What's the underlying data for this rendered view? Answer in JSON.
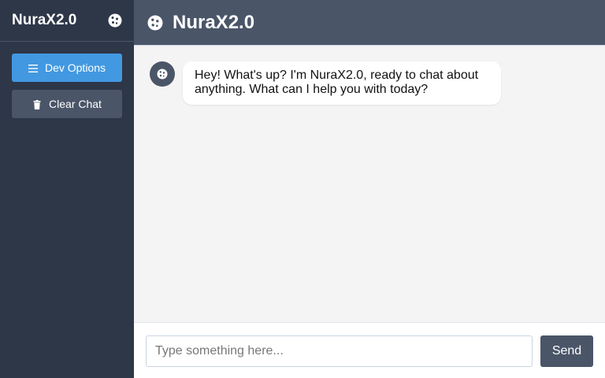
{
  "app": {
    "name": "NuraX2.0",
    "logo_icon": "cookie-icon"
  },
  "sidebar": {
    "title": "NuraX2.0",
    "buttons": [
      {
        "label": "Dev Options",
        "icon": "menu-icon",
        "color": "#4299e1"
      },
      {
        "label": "Clear Chat",
        "icon": "trash-icon",
        "color": "#4a5568"
      }
    ]
  },
  "header": {
    "title": "NuraX2.0"
  },
  "chat": {
    "messages": [
      {
        "sender": "bot",
        "avatar_icon": "cookie-icon",
        "text": "Hey! What's up? I'm NuraX2.0, ready to chat about anything. What can I help you with today?"
      }
    ]
  },
  "composer": {
    "placeholder": "Type something here...",
    "value": "",
    "send_label": "Send"
  },
  "colors": {
    "sidebar_bg": "#2d3748",
    "header_bg": "#4a5568",
    "accent": "#4299e1",
    "chat_bg": "#f4f4f4"
  }
}
